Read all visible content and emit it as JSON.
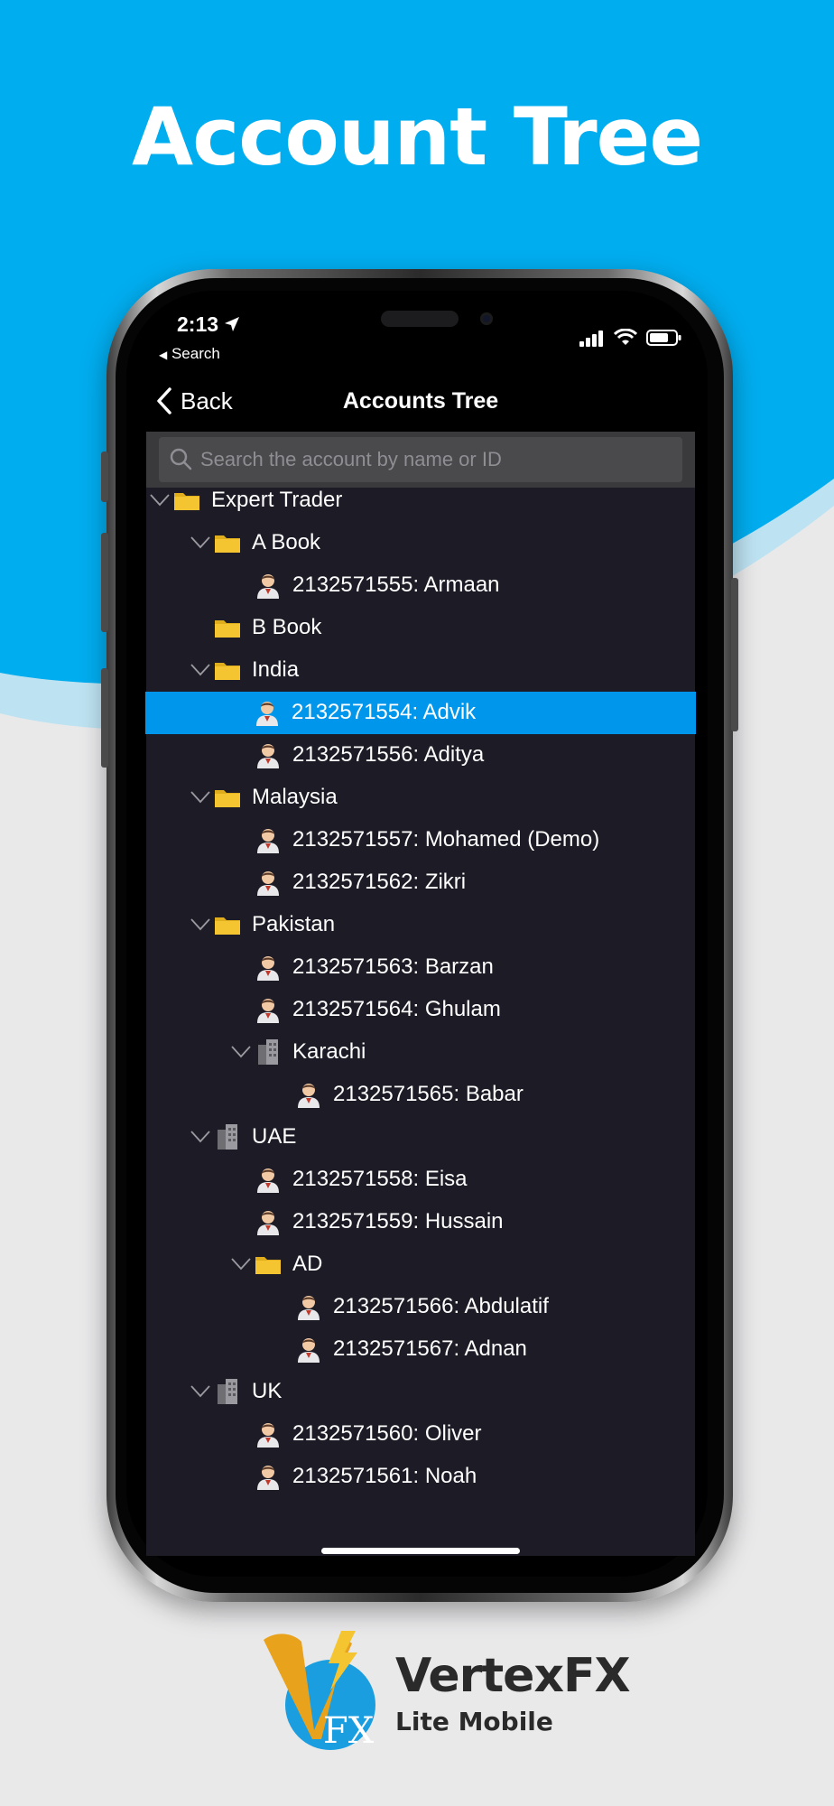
{
  "headline": "Account Tree",
  "status_bar": {
    "time": "2:13",
    "back_app": "Search"
  },
  "nav": {
    "back_label": "Back",
    "title": "Accounts Tree"
  },
  "search": {
    "placeholder": "Search the account by name or ID",
    "value": ""
  },
  "tree": [
    {
      "label": "Expert Trader",
      "level": 0,
      "icon": "folder-icon",
      "expanded": true,
      "selected": false
    },
    {
      "label": "A Book",
      "level": 1,
      "icon": "folder-icon",
      "expanded": true,
      "selected": false
    },
    {
      "label": "2132571555: Armaan",
      "level": 2,
      "icon": "user-icon",
      "selected": false
    },
    {
      "label": "B Book",
      "level": 1,
      "icon": "folder-icon",
      "expanded": false,
      "selected": false
    },
    {
      "label": "India",
      "level": 1,
      "icon": "folder-icon",
      "expanded": true,
      "selected": false
    },
    {
      "label": "2132571554: Advik",
      "level": 2,
      "icon": "user-icon",
      "selected": true
    },
    {
      "label": "2132571556: Aditya",
      "level": 2,
      "icon": "user-icon",
      "selected": false
    },
    {
      "label": "Malaysia",
      "level": 1,
      "icon": "folder-icon",
      "expanded": true,
      "selected": false
    },
    {
      "label": "2132571557: Mohamed (Demo)",
      "level": 2,
      "icon": "user-icon",
      "selected": false
    },
    {
      "label": "2132571562: Zikri",
      "level": 2,
      "icon": "user-icon",
      "selected": false
    },
    {
      "label": "Pakistan",
      "level": 1,
      "icon": "folder-icon",
      "expanded": true,
      "selected": false
    },
    {
      "label": "2132571563: Barzan",
      "level": 2,
      "icon": "user-icon",
      "selected": false
    },
    {
      "label": "2132571564: Ghulam",
      "level": 2,
      "icon": "user-icon",
      "selected": false
    },
    {
      "label": "Karachi",
      "level": 2,
      "icon": "building-icon",
      "expanded": true,
      "selected": false
    },
    {
      "label": "2132571565: Babar",
      "level": 3,
      "icon": "user-icon",
      "selected": false
    },
    {
      "label": "UAE",
      "level": 1,
      "icon": "building-icon",
      "expanded": true,
      "selected": false
    },
    {
      "label": "2132571558: Eisa",
      "level": 2,
      "icon": "user-icon",
      "selected": false
    },
    {
      "label": "2132571559: Hussain",
      "level": 2,
      "icon": "user-icon",
      "selected": false
    },
    {
      "label": "AD",
      "level": 2,
      "icon": "folder-icon",
      "expanded": true,
      "selected": false
    },
    {
      "label": "2132571566: Abdulatif",
      "level": 3,
      "icon": "user-icon",
      "selected": false
    },
    {
      "label": "2132571567: Adnan",
      "level": 3,
      "icon": "user-icon",
      "selected": false
    },
    {
      "label": "UK",
      "level": 1,
      "icon": "building-icon",
      "expanded": true,
      "selected": false
    },
    {
      "label": "2132571560: Oliver",
      "level": 2,
      "icon": "user-icon",
      "selected": false
    },
    {
      "label": "2132571561: Noah",
      "level": 2,
      "icon": "user-icon",
      "selected": false
    }
  ],
  "logo": {
    "brand": "VertexFX",
    "tagline": "Lite Mobile",
    "mark_text": "FX"
  },
  "colors": {
    "background_blue": "#00adef",
    "selection": "#0096ec",
    "tree_bg": "#1d1b25",
    "folder": "#f4c531"
  }
}
